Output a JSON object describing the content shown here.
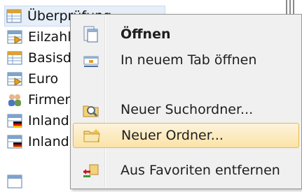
{
  "tree": {
    "items": [
      {
        "label": "Überprüfung",
        "icon": "table-icon",
        "selected": true
      },
      {
        "label": "Eilzahlungen",
        "icon": "table-arrow-icon"
      },
      {
        "label": "Basisdaten",
        "icon": "table-icon"
      },
      {
        "label": "Euro",
        "icon": "table-arrow-icon"
      },
      {
        "label": "Firmen",
        "icon": "people-icon"
      },
      {
        "label": "Inland",
        "icon": "table-flag-icon"
      },
      {
        "label": "Inland",
        "icon": "table-flag-icon"
      }
    ]
  },
  "menu": {
    "items": [
      {
        "label": "Öffnen",
        "icon": "open-icon",
        "bold": true
      },
      {
        "label": "In neuem Tab öffnen",
        "icon": "new-tab-icon"
      },
      {
        "label": "Neuer Suchordner...",
        "icon": "search-folder-icon"
      },
      {
        "label": "Neuer Ordner...",
        "icon": "new-folder-icon",
        "highlight": true
      },
      {
        "label": "Aus Favoriten entfernen",
        "icon": "remove-favorite-icon"
      }
    ]
  },
  "colors": {
    "highlight_border": "#e8b84e",
    "highlight_fill": "#fbe3a7",
    "menu_bg": "#f0f0f0"
  }
}
